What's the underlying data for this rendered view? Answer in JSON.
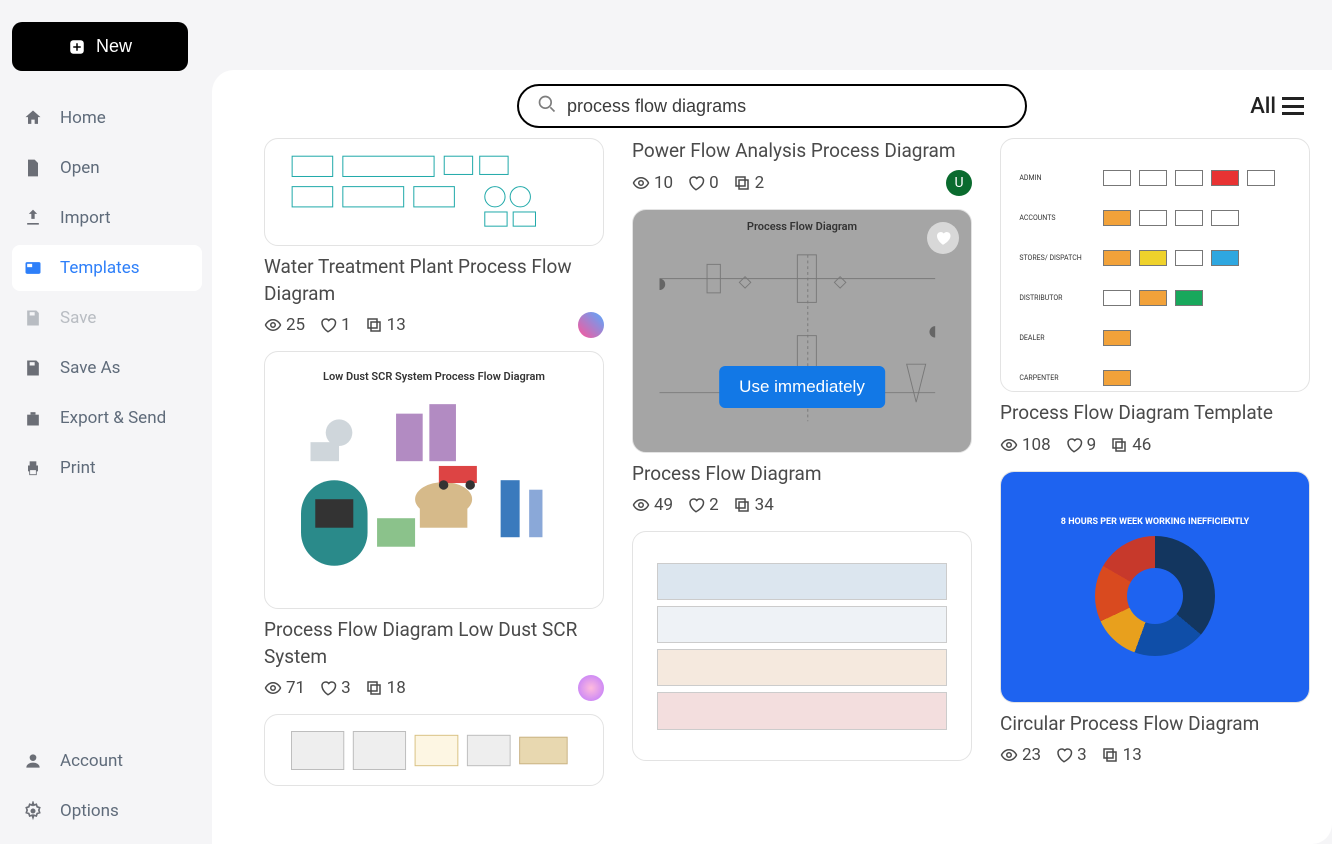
{
  "new_button": {
    "label": "New"
  },
  "sidebar": {
    "items": [
      {
        "label": "Home"
      },
      {
        "label": "Open"
      },
      {
        "label": "Import"
      },
      {
        "label": "Templates"
      },
      {
        "label": "Save"
      },
      {
        "label": "Save As"
      },
      {
        "label": "Export & Send"
      },
      {
        "label": "Print"
      },
      {
        "label": "Account"
      },
      {
        "label": "Options"
      }
    ]
  },
  "search": {
    "value": "process flow diagrams",
    "placeholder": "Search"
  },
  "filter_label": "All",
  "use_immediately": "Use immediately",
  "cards": {
    "water": {
      "title": "Water Treatment Plant Process Flow Diagram",
      "views": "25",
      "likes": "1",
      "copies": "13"
    },
    "lowdust": {
      "title": "Process Flow Diagram Low Dust SCR System",
      "thumb_title": "Low Dust SCR System Process Flow Diagram",
      "views": "71",
      "likes": "3",
      "copies": "18"
    },
    "power": {
      "title": "Power Flow Analysis Process Diagram",
      "views": "10",
      "likes": "0",
      "copies": "2"
    },
    "pfd": {
      "title": "Process Flow Diagram",
      "thumb_title": "Process Flow Diagram",
      "views": "49",
      "likes": "2",
      "copies": "34"
    },
    "template": {
      "title": "Process Flow Diagram Template",
      "views": "108",
      "likes": "9",
      "copies": "46"
    },
    "circular": {
      "title": "Circular Process Flow Diagram",
      "donut_title": "8 HOURS PER WEEK WORKING INEFFICIENTLY",
      "views": "23",
      "likes": "3",
      "copies": "13"
    }
  },
  "grid_labels": [
    "ADMIN",
    "ACCOUNTS",
    "STORES/ DISPATCH",
    "DISTRIBUTOR",
    "DEALER",
    "CARPENTER"
  ]
}
